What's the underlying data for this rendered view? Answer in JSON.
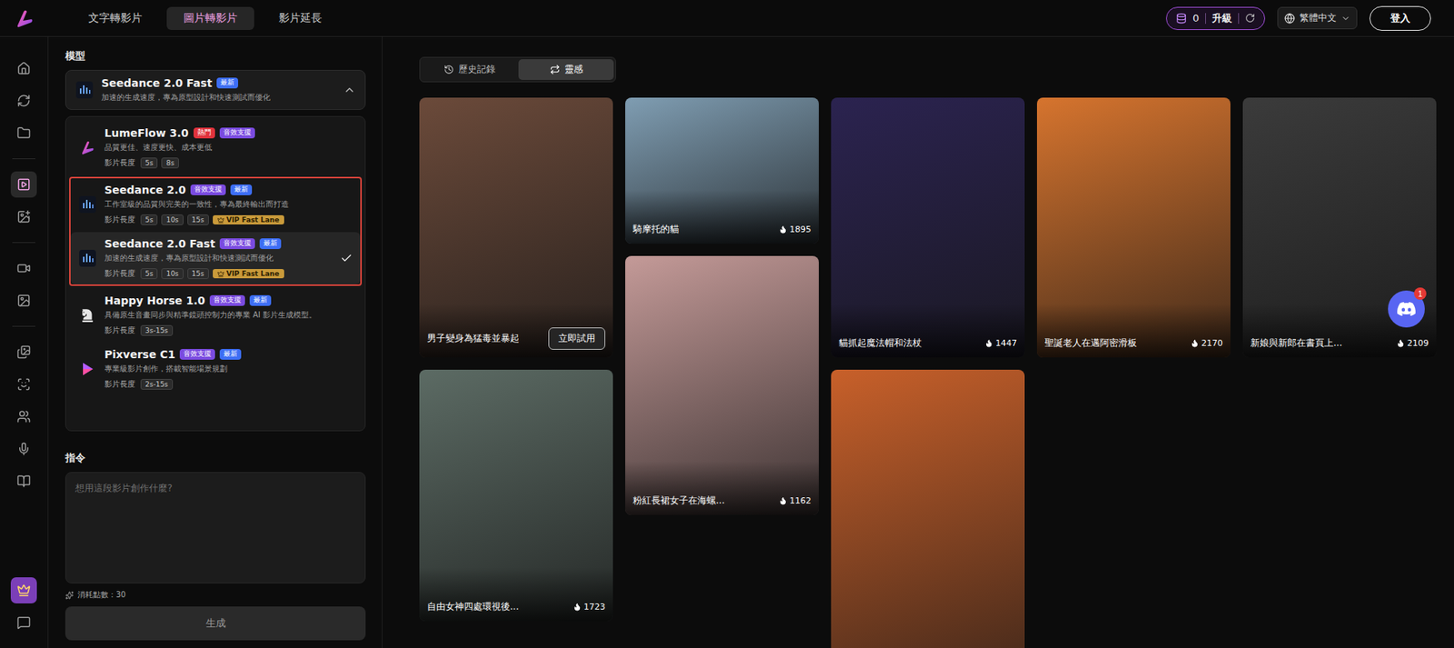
{
  "top_tabs": [
    {
      "label": "文字轉影片",
      "selected": false
    },
    {
      "label": "圖片轉影片",
      "selected": true
    },
    {
      "label": "影片延長",
      "selected": false
    }
  ],
  "credits": {
    "balance": "0",
    "upgrade": "升級"
  },
  "language": {
    "label": "繁體中文"
  },
  "login": {
    "label": "登入"
  },
  "sidebar": {
    "items": [
      {
        "kind": "nav",
        "selected": false
      },
      {
        "kind": "nav",
        "selected": false
      },
      {
        "kind": "nav",
        "selected": false
      },
      {
        "kind": "nav",
        "selected": true
      },
      {
        "kind": "nav",
        "selected": false
      },
      {
        "kind": "nav",
        "selected": false
      },
      {
        "kind": "nav",
        "selected": false
      },
      {
        "kind": "nav",
        "selected": false
      },
      {
        "kind": "nav",
        "selected": false
      },
      {
        "kind": "nav",
        "selected": false
      },
      {
        "kind": "nav",
        "selected": false
      },
      {
        "kind": "nav",
        "selected": false
      },
      {
        "kind": "vip",
        "selected": false
      },
      {
        "kind": "nav",
        "selected": false
      }
    ]
  },
  "model_panel": {
    "label": "模型",
    "current": {
      "name": "Seedance 2.0 Fast",
      "badges": [
        {
          "label": "最新",
          "color": "#3d6ef5"
        }
      ],
      "description": "加速的生成速度，專為原型設計和快速測試而優化",
      "expanded": true
    },
    "models": [
      {
        "name": "LumeFlow 3.0",
        "badges": [
          {
            "label": "熱門",
            "color": "#e0323c"
          },
          {
            "label": "音效支援",
            "color": "#7a4be0"
          }
        ],
        "description": "品質更佳、速度更快、成本更低",
        "length_label": "影片長度",
        "lengths": [
          "5s",
          "8s"
        ],
        "selected": false,
        "highlighted": false
      },
      {
        "name": "Seedance 2.0",
        "badges": [
          {
            "label": "音效支援",
            "color": "#7a4be0"
          },
          {
            "label": "最新",
            "color": "#3d6ef5"
          }
        ],
        "description": "工作室級的品質與完美的一致性，專為最終輸出而打造",
        "length_label": "影片長度",
        "lengths": [
          "5s",
          "10s",
          "15s"
        ],
        "vip": "VIP Fast Lane",
        "selected": false,
        "highlighted": true
      },
      {
        "name": "Seedance 2.0 Fast",
        "badges": [
          {
            "label": "音效支援",
            "color": "#7a4be0"
          },
          {
            "label": "最新",
            "color": "#3d6ef5"
          }
        ],
        "description": "加速的生成速度，專為原型設計和快速測試而優化",
        "length_label": "影片長度",
        "lengths": [
          "5s",
          "10s",
          "15s"
        ],
        "vip": "VIP Fast Lane",
        "selected": true,
        "highlighted": true
      },
      {
        "name": "Happy Horse 1.0",
        "badges": [
          {
            "label": "音效支援",
            "color": "#7a4be0"
          },
          {
            "label": "最新",
            "color": "#3d6ef5"
          }
        ],
        "description": "具備原生音畫同步與精準鏡頭控制力的專業 AI 影片生成模型。",
        "length_label": "影片長度",
        "lengths": [
          "3s-15s"
        ],
        "selected": false,
        "highlighted": false
      },
      {
        "name": "Pixverse C1",
        "badges": [
          {
            "label": "音效支援",
            "color": "#7a4be0"
          },
          {
            "label": "最新",
            "color": "#3d6ef5"
          }
        ],
        "description": "專業級影片創作，搭載智能場景規劃",
        "length_label": "影片長度",
        "lengths": [
          "2s-15s"
        ],
        "selected": false,
        "highlighted": false
      }
    ]
  },
  "prompt": {
    "label": "指令",
    "placeholder": "想用這段影片創作什麼?",
    "cost": "消耗點數：30",
    "submit": "生成"
  },
  "gallery": {
    "tabs": [
      {
        "label": "歷史記錄",
        "selected": false
      },
      {
        "label": "靈感",
        "selected": true
      }
    ],
    "columns": [
      {
        "cards": [
          {
            "caption": "男子變身為猛毒並暴起",
            "hovered": true,
            "action": "立即試用",
            "color": "#6b4a3a"
          },
          {
            "caption": "自由女神四處環視後...",
            "likes": "1723",
            "hovered": false,
            "color": "#5c6b64"
          }
        ]
      },
      {
        "cards": [
          {
            "caption": "騎摩托的貓",
            "likes": "1895",
            "hovered": false,
            "color": "#7f9db2"
          },
          {
            "caption": "粉紅長裙女子在海螺...",
            "likes": "1162",
            "hovered": false,
            "color": "#c49a98"
          }
        ]
      },
      {
        "cards": [
          {
            "caption": "貓抓起魔法帽和法杖",
            "likes": "1447",
            "hovered": false,
            "color": "#2b2350"
          },
          {
            "hovered": false,
            "color": "#c8602a"
          }
        ]
      },
      {
        "cards": [
          {
            "caption": "聖誕老人在邁阿密滑板",
            "likes": "2170",
            "hovered": false,
            "color": "#d6742e"
          }
        ]
      },
      {
        "cards": [
          {
            "caption": "新娘與新郎在書頁上...",
            "likes": "2109",
            "hovered": false,
            "color": "#3b3b3b"
          }
        ]
      }
    ]
  },
  "support": {
    "badge": "1"
  }
}
